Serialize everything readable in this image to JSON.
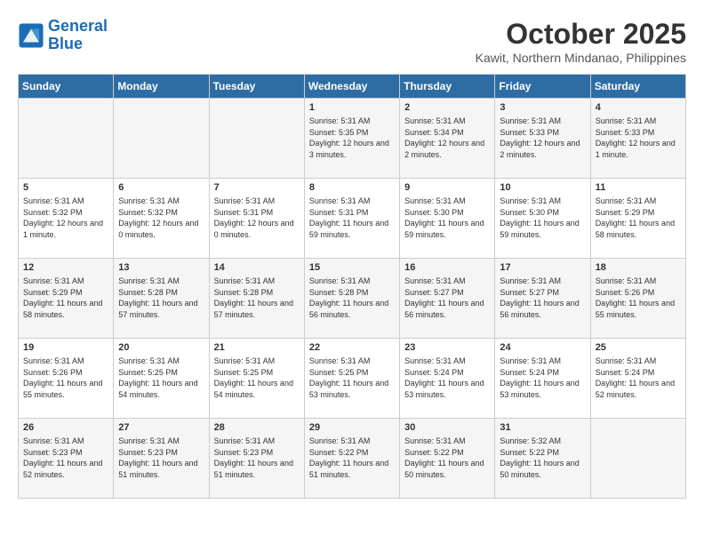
{
  "header": {
    "logo_line1": "General",
    "logo_line2": "Blue",
    "month_title": "October 2025",
    "location": "Kawit, Northern Mindanao, Philippines"
  },
  "days_of_week": [
    "Sunday",
    "Monday",
    "Tuesday",
    "Wednesday",
    "Thursday",
    "Friday",
    "Saturday"
  ],
  "weeks": [
    [
      {
        "day": "",
        "info": ""
      },
      {
        "day": "",
        "info": ""
      },
      {
        "day": "",
        "info": ""
      },
      {
        "day": "1",
        "info": "Sunrise: 5:31 AM\nSunset: 5:35 PM\nDaylight: 12 hours and 3 minutes."
      },
      {
        "day": "2",
        "info": "Sunrise: 5:31 AM\nSunset: 5:34 PM\nDaylight: 12 hours and 2 minutes."
      },
      {
        "day": "3",
        "info": "Sunrise: 5:31 AM\nSunset: 5:33 PM\nDaylight: 12 hours and 2 minutes."
      },
      {
        "day": "4",
        "info": "Sunrise: 5:31 AM\nSunset: 5:33 PM\nDaylight: 12 hours and 1 minute."
      }
    ],
    [
      {
        "day": "5",
        "info": "Sunrise: 5:31 AM\nSunset: 5:32 PM\nDaylight: 12 hours and 1 minute."
      },
      {
        "day": "6",
        "info": "Sunrise: 5:31 AM\nSunset: 5:32 PM\nDaylight: 12 hours and 0 minutes."
      },
      {
        "day": "7",
        "info": "Sunrise: 5:31 AM\nSunset: 5:31 PM\nDaylight: 12 hours and 0 minutes."
      },
      {
        "day": "8",
        "info": "Sunrise: 5:31 AM\nSunset: 5:31 PM\nDaylight: 11 hours and 59 minutes."
      },
      {
        "day": "9",
        "info": "Sunrise: 5:31 AM\nSunset: 5:30 PM\nDaylight: 11 hours and 59 minutes."
      },
      {
        "day": "10",
        "info": "Sunrise: 5:31 AM\nSunset: 5:30 PM\nDaylight: 11 hours and 59 minutes."
      },
      {
        "day": "11",
        "info": "Sunrise: 5:31 AM\nSunset: 5:29 PM\nDaylight: 11 hours and 58 minutes."
      }
    ],
    [
      {
        "day": "12",
        "info": "Sunrise: 5:31 AM\nSunset: 5:29 PM\nDaylight: 11 hours and 58 minutes."
      },
      {
        "day": "13",
        "info": "Sunrise: 5:31 AM\nSunset: 5:28 PM\nDaylight: 11 hours and 57 minutes."
      },
      {
        "day": "14",
        "info": "Sunrise: 5:31 AM\nSunset: 5:28 PM\nDaylight: 11 hours and 57 minutes."
      },
      {
        "day": "15",
        "info": "Sunrise: 5:31 AM\nSunset: 5:28 PM\nDaylight: 11 hours and 56 minutes."
      },
      {
        "day": "16",
        "info": "Sunrise: 5:31 AM\nSunset: 5:27 PM\nDaylight: 11 hours and 56 minutes."
      },
      {
        "day": "17",
        "info": "Sunrise: 5:31 AM\nSunset: 5:27 PM\nDaylight: 11 hours and 56 minutes."
      },
      {
        "day": "18",
        "info": "Sunrise: 5:31 AM\nSunset: 5:26 PM\nDaylight: 11 hours and 55 minutes."
      }
    ],
    [
      {
        "day": "19",
        "info": "Sunrise: 5:31 AM\nSunset: 5:26 PM\nDaylight: 11 hours and 55 minutes."
      },
      {
        "day": "20",
        "info": "Sunrise: 5:31 AM\nSunset: 5:25 PM\nDaylight: 11 hours and 54 minutes."
      },
      {
        "day": "21",
        "info": "Sunrise: 5:31 AM\nSunset: 5:25 PM\nDaylight: 11 hours and 54 minutes."
      },
      {
        "day": "22",
        "info": "Sunrise: 5:31 AM\nSunset: 5:25 PM\nDaylight: 11 hours and 53 minutes."
      },
      {
        "day": "23",
        "info": "Sunrise: 5:31 AM\nSunset: 5:24 PM\nDaylight: 11 hours and 53 minutes."
      },
      {
        "day": "24",
        "info": "Sunrise: 5:31 AM\nSunset: 5:24 PM\nDaylight: 11 hours and 53 minutes."
      },
      {
        "day": "25",
        "info": "Sunrise: 5:31 AM\nSunset: 5:24 PM\nDaylight: 11 hours and 52 minutes."
      }
    ],
    [
      {
        "day": "26",
        "info": "Sunrise: 5:31 AM\nSunset: 5:23 PM\nDaylight: 11 hours and 52 minutes."
      },
      {
        "day": "27",
        "info": "Sunrise: 5:31 AM\nSunset: 5:23 PM\nDaylight: 11 hours and 51 minutes."
      },
      {
        "day": "28",
        "info": "Sunrise: 5:31 AM\nSunset: 5:23 PM\nDaylight: 11 hours and 51 minutes."
      },
      {
        "day": "29",
        "info": "Sunrise: 5:31 AM\nSunset: 5:22 PM\nDaylight: 11 hours and 51 minutes."
      },
      {
        "day": "30",
        "info": "Sunrise: 5:31 AM\nSunset: 5:22 PM\nDaylight: 11 hours and 50 minutes."
      },
      {
        "day": "31",
        "info": "Sunrise: 5:32 AM\nSunset: 5:22 PM\nDaylight: 11 hours and 50 minutes."
      },
      {
        "day": "",
        "info": ""
      }
    ]
  ]
}
